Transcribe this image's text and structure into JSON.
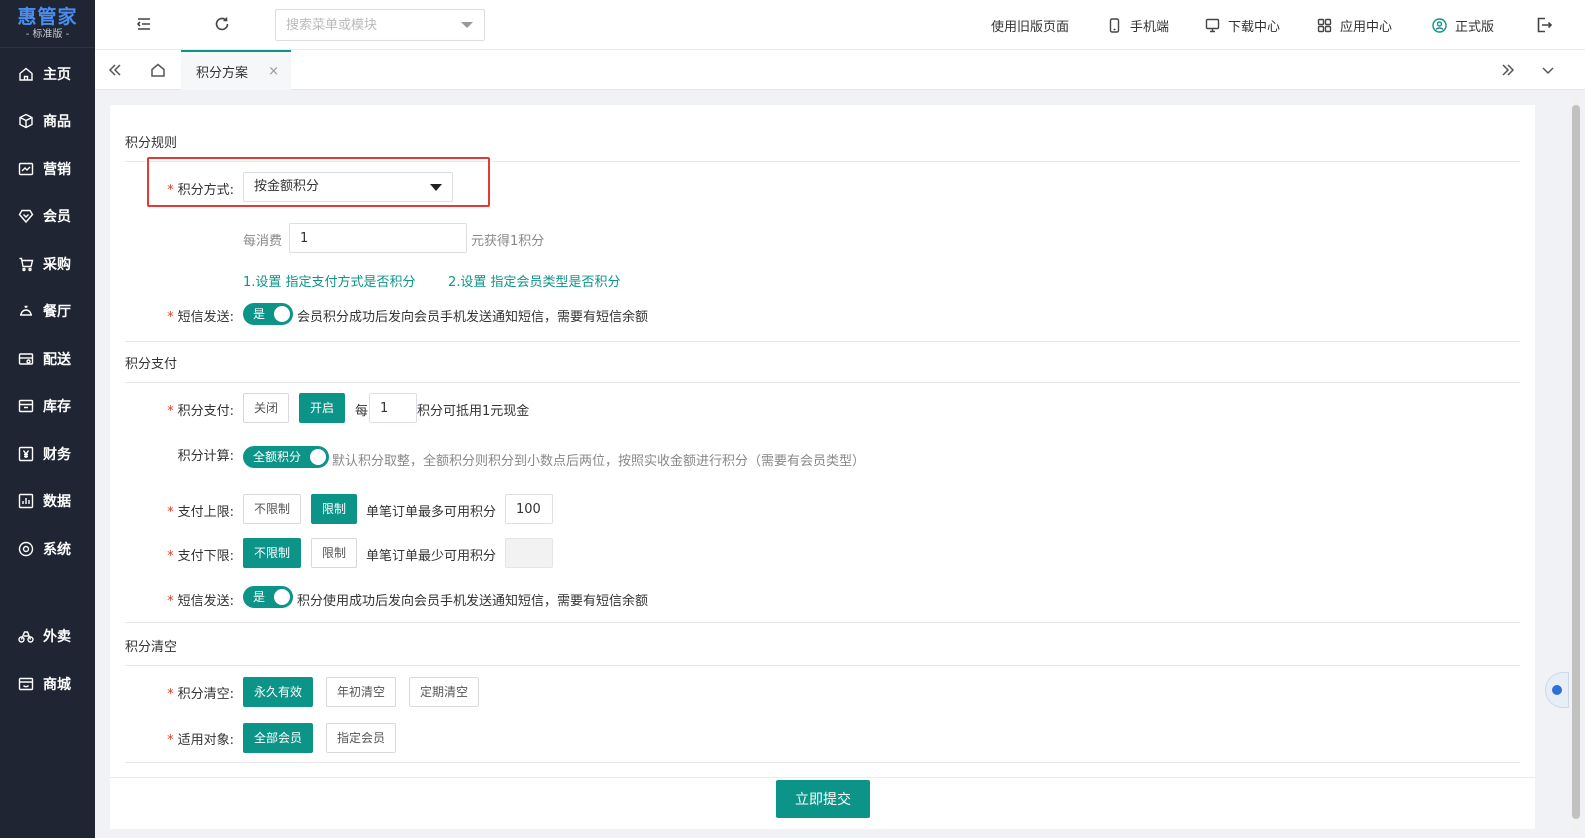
{
  "logo": {
    "main": "惠管家",
    "sub": "- 标准版 -"
  },
  "sidebar": {
    "items": [
      {
        "label": "主页",
        "icon": "home-icon"
      },
      {
        "label": "商品",
        "icon": "box-icon"
      },
      {
        "label": "营销",
        "icon": "chart-icon"
      },
      {
        "label": "会员",
        "icon": "diamond-icon"
      },
      {
        "label": "采购",
        "icon": "cart-icon"
      },
      {
        "label": "餐厅",
        "icon": "bell-icon"
      },
      {
        "label": "配送",
        "icon": "truck-icon"
      },
      {
        "label": "库存",
        "icon": "warehouse-icon"
      },
      {
        "label": "财务",
        "icon": "yen-icon"
      },
      {
        "label": "数据",
        "icon": "bar-chart-icon"
      },
      {
        "label": "系统",
        "icon": "settings-icon"
      },
      {
        "label": "外卖",
        "icon": "bike-icon"
      },
      {
        "label": "商城",
        "icon": "store-icon"
      }
    ]
  },
  "header": {
    "search_placeholder": "搜索菜单或模块",
    "links": {
      "old_version": "使用旧版页面",
      "mobile": "手机端",
      "download": "下载中心",
      "apps": "应用中心",
      "edition": "正式版"
    }
  },
  "tabs": {
    "active": "积分方案",
    "close": "×"
  },
  "sections": {
    "rules": "积分规则",
    "payment": "积分支付",
    "clear": "积分清空"
  },
  "rules": {
    "method_label": "积分方式:",
    "method_value": "按金额积分",
    "consume_prefix": "每消费",
    "consume_value": "1",
    "consume_suffix": "元获得1积分",
    "link1": "1.设置 指定支付方式是否积分",
    "link2": "2.设置 指定会员类型是否积分",
    "sms_label": "短信发送:",
    "sms_switch": "是",
    "sms_desc": "会员积分成功后发向会员手机发送通知短信，需要有短信余额"
  },
  "payment": {
    "pay_label": "积分支付:",
    "pay_off": "关闭",
    "pay_on": "开启",
    "pay_prefix": "每",
    "pay_value": "1",
    "pay_suffix": "积分可抵用1元现金",
    "calc_label": "积分计算:",
    "calc_switch": "全额积分",
    "calc_desc": "默认积分取整，全额积分则积分到小数点后两位，按照实收金额进行积分（需要有会员类型）",
    "upper_label": "支付上限:",
    "upper_unlimited": "不限制",
    "upper_limited": "限制",
    "upper_desc": "单笔订单最多可用积分",
    "upper_value": "100",
    "lower_label": "支付下限:",
    "lower_unlimited": "不限制",
    "lower_limited": "限制",
    "lower_desc": "单笔订单最少可用积分",
    "lower_value": "",
    "sms_label": "短信发送:",
    "sms_switch": "是",
    "sms_desc": "积分使用成功后发向会员手机发送通知短信，需要有短信余额"
  },
  "clear": {
    "clear_label": "积分清空:",
    "permanent": "永久有效",
    "year_start": "年初清空",
    "periodic": "定期清空",
    "target_label": "适用对象:",
    "all_members": "全部会员",
    "specific_members": "指定会员"
  },
  "submit": "立即提交",
  "colors": {
    "primary": "#0d9488",
    "sidebar": "#1f2532",
    "required": "#e03a1e",
    "highlight": "#e53935"
  }
}
